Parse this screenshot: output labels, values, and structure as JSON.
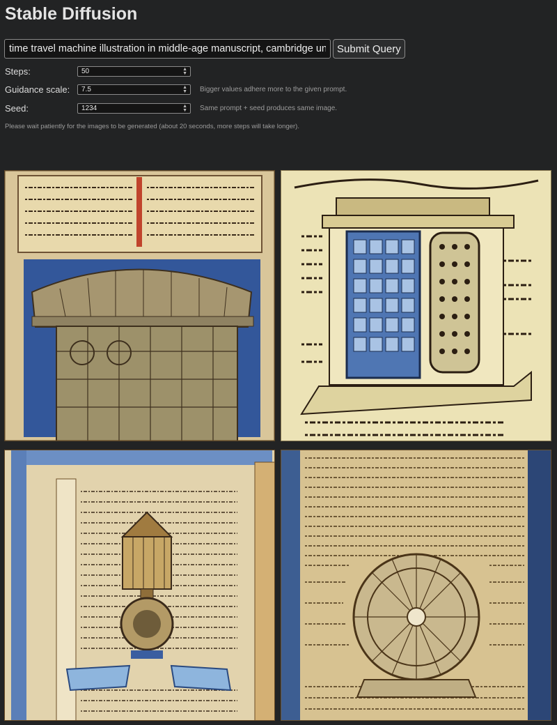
{
  "app": {
    "title": "Stable Diffusion"
  },
  "form": {
    "prompt_value": "time travel machine illustration in middle-age manuscript, cambridge univ",
    "submit_label": "Submit Query",
    "steps": {
      "label": "Steps:",
      "value": "50"
    },
    "guidance": {
      "label": "Guidance scale:",
      "value": "7.5",
      "hint": "Bigger values adhere more to the given prompt."
    },
    "seed": {
      "label": "Seed:",
      "value": "1234",
      "hint": "Same prompt + seed produces same image."
    },
    "wait_note": "Please wait patiently for the images to be generated (about 20 seconds, more steps will take longer)."
  },
  "results": {
    "images": [
      {
        "name": "generated-image-1"
      },
      {
        "name": "generated-image-2"
      },
      {
        "name": "generated-image-3"
      },
      {
        "name": "generated-image-4"
      }
    ]
  },
  "colors": {
    "background": "#222324",
    "parchment": "#e6d6a4",
    "manuscript_blue": "#3c62a0",
    "ink": "#2b1e12"
  }
}
